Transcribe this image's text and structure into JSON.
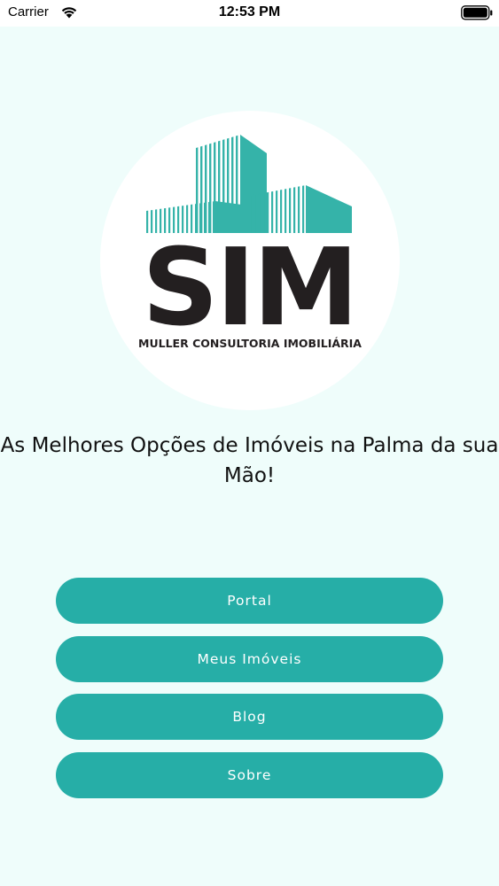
{
  "status_bar": {
    "carrier": "Carrier",
    "time": "12:53 PM",
    "icons": [
      "wifi-icon",
      "battery-icon"
    ]
  },
  "logo": {
    "wordmark": "SIM",
    "subtitle": "MULLER CONSULTORIA IMOBILIÁRIA",
    "colors": {
      "teal": "#35b3a9",
      "dark": "#231f20"
    }
  },
  "tagline": "As Melhores Opções de Imóveis na Palma da sua Mão!",
  "menu": {
    "portal_label": "Portal",
    "meus_imoveis_label": "Meus Imóveis",
    "blog_label": "Blog",
    "sobre_label": "Sobre"
  },
  "theme": {
    "background": "#effdfb",
    "button": "#26aea7",
    "button_text": "#ffffff"
  }
}
